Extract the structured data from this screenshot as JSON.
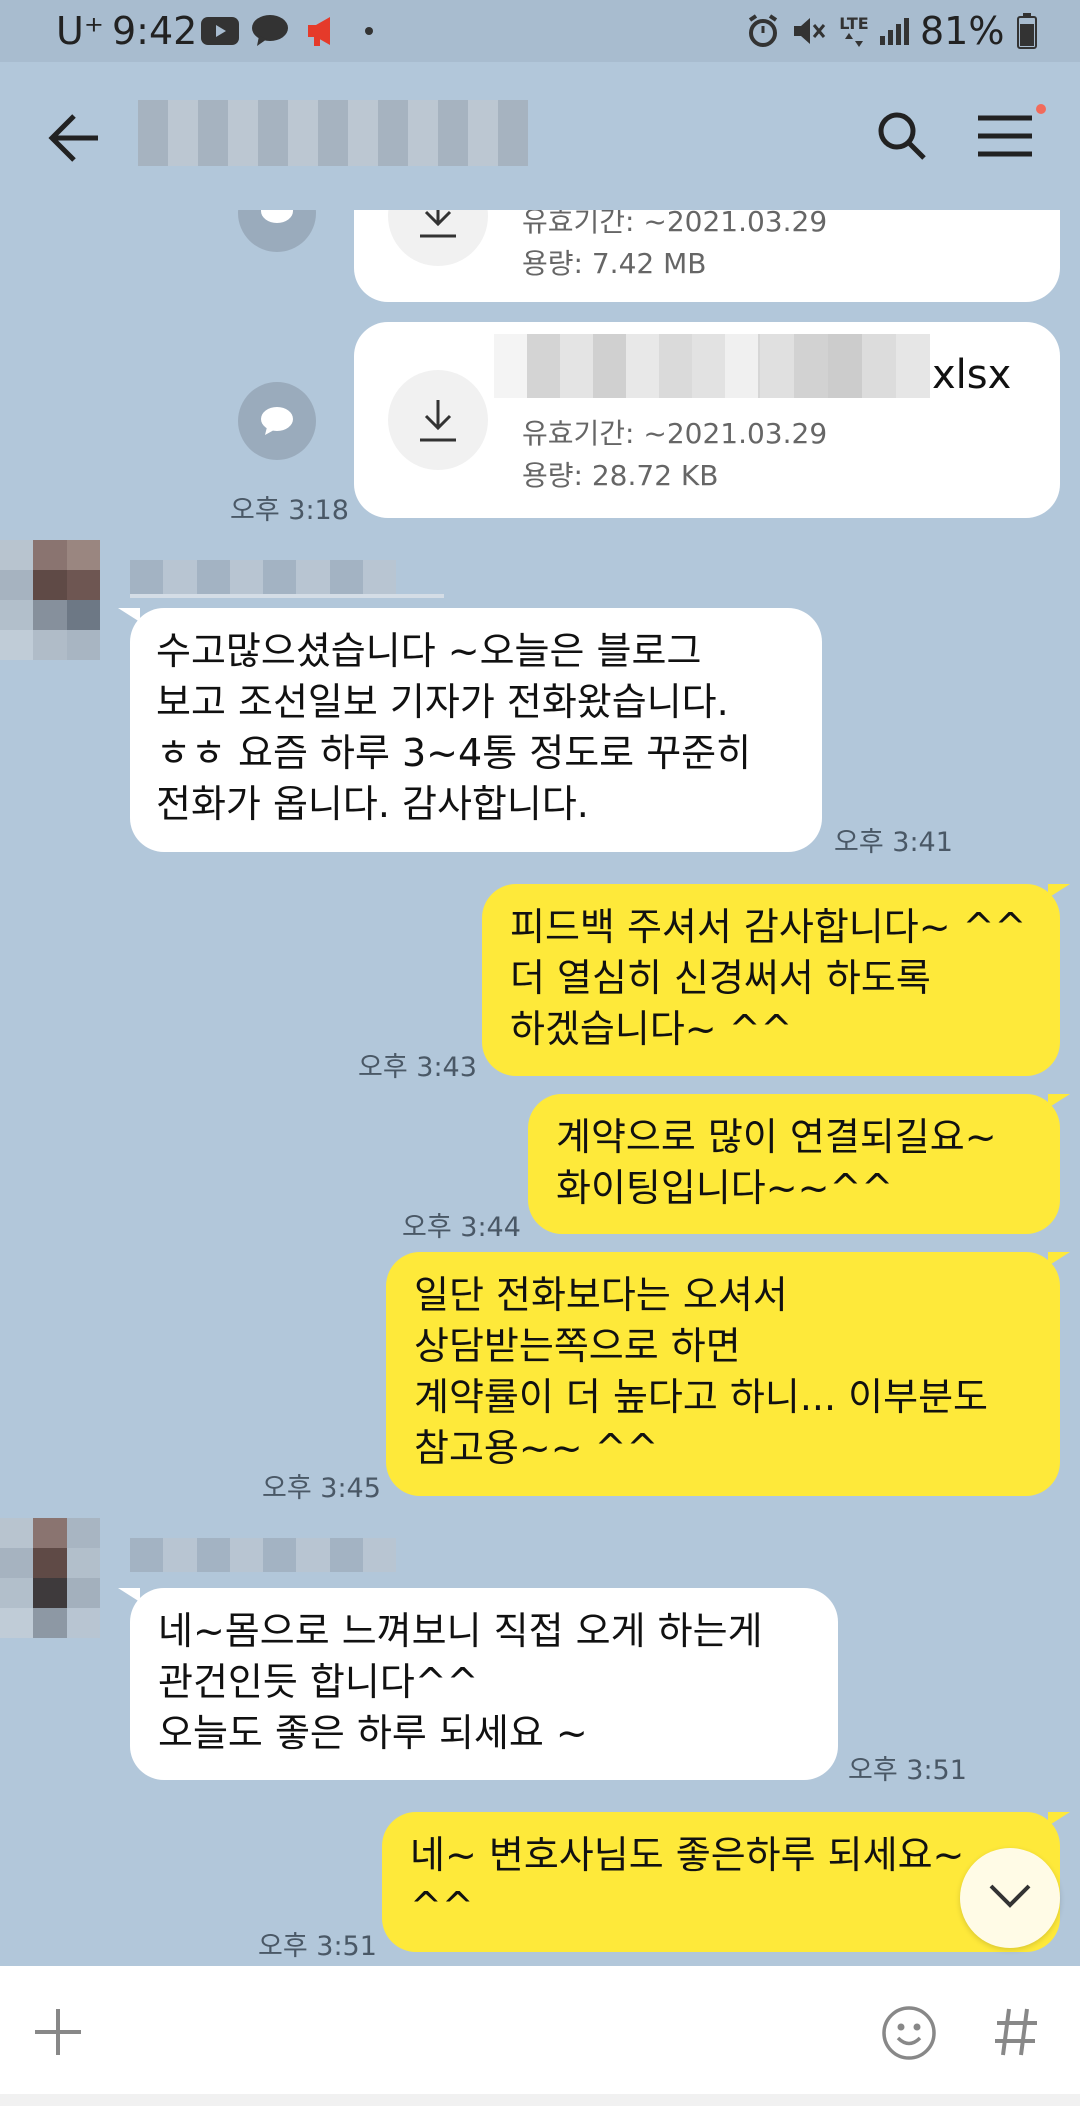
{
  "status_bar": {
    "carrier": "U⁺",
    "time": "9:42",
    "battery": "81%",
    "network": "LTE",
    "icons": [
      "youtube-icon",
      "talk-icon",
      "megaphone-icon",
      "dot-icon",
      "alarm-icon",
      "mute-icon",
      "lte-icon",
      "signal-icon",
      "battery-icon"
    ]
  },
  "header": {
    "title": "",
    "icons": [
      "back-arrow-icon",
      "search-icon",
      "menu-icon"
    ],
    "menu_badge_color": "#f26b5b"
  },
  "files": [
    {
      "expiry": "유효기간: ~2021.03.29",
      "size": "용량: 7.42 MB"
    },
    {
      "filename_ext": "xlsx",
      "expiry": "유효기간: ~2021.03.29",
      "size": "용량: 28.72 KB",
      "time": "오후 3:18"
    }
  ],
  "messages": [
    {
      "side": "in",
      "text": "수고많으셨습니다 ~오늘은 블로그\n보고 조선일보 기자가 전화왔습니다.\nㅎㅎ 요즘 하루 3~4통 정도로 꾸준히\n전화가 옵니다. 감사합니다.",
      "time": "오후 3:41"
    },
    {
      "side": "out",
      "text": "피드백 주셔서 감사합니다~ ^^\n더 열심히 신경써서 하도록\n하겠습니다~ ^^",
      "time": "오후 3:43"
    },
    {
      "side": "out",
      "text": "계약으로 많이 연결되길요~\n화이팅입니다~~^^",
      "time": "오후 3:44"
    },
    {
      "side": "out",
      "text": "일단 전화보다는 오셔서\n상담받는쪽으로 하면\n계약률이 더 높다고 하니... 이부분도\n참고용~~ ^^",
      "time": "오후 3:45"
    },
    {
      "side": "in",
      "text": "네~몸으로 느껴보니 직접 오게 하는게\n관건인듯 합니다^^\n오늘도 좋은 하루 되세요 ~",
      "time": "오후 3:51"
    },
    {
      "side": "out",
      "text": "네~ 변호사님도 좋은하루 되세요~\n^^",
      "time": "오후 3:51"
    }
  ],
  "input_bar": {
    "icons": [
      "plus-icon",
      "emoji-icon",
      "hashtag-icon"
    ]
  },
  "colors": {
    "background": "#b2c7da",
    "outgoing_bubble": "#fee93a",
    "incoming_bubble": "#ffffff"
  }
}
